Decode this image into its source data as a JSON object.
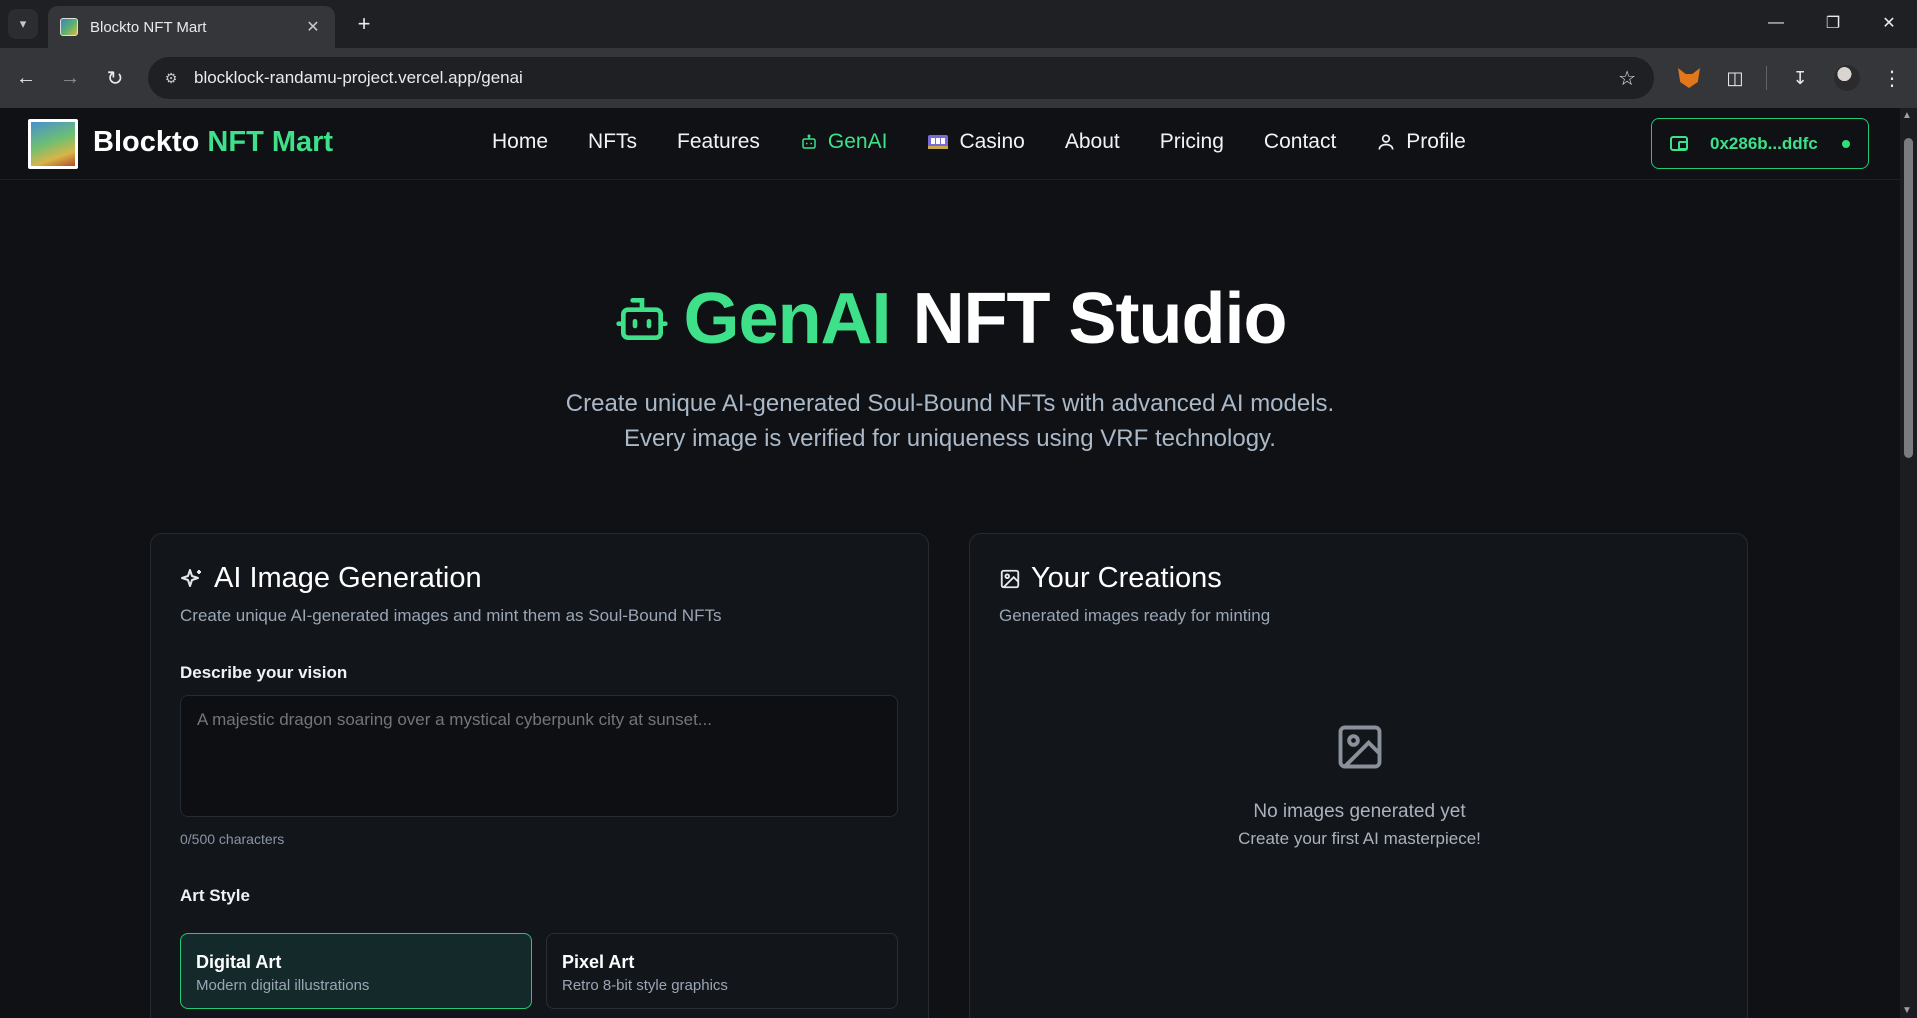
{
  "browser": {
    "tab_title": "Blockto NFT Mart",
    "url": "blocklock-randamu-project.vercel.app/genai"
  },
  "site": {
    "brand_main": "Blockto",
    "brand_accent": "NFT Mart",
    "nav": [
      {
        "label": "Home",
        "icon": ""
      },
      {
        "label": "NFTs",
        "icon": ""
      },
      {
        "label": "Features",
        "icon": ""
      },
      {
        "label": "GenAI",
        "icon": "bot-icon",
        "active": true
      },
      {
        "label": "Casino",
        "icon": "slot-machine-icon"
      },
      {
        "label": "About",
        "icon": ""
      },
      {
        "label": "Pricing",
        "icon": ""
      },
      {
        "label": "Contact",
        "icon": ""
      },
      {
        "label": "Profile",
        "icon": "user-icon"
      }
    ],
    "wallet_address": "0x286b...ddfc"
  },
  "hero": {
    "title_accent": "GenAI",
    "title_rest": "NFT Studio",
    "subtitle_line1": "Create unique AI-generated Soul-Bound NFTs with advanced AI models.",
    "subtitle_line2": "Every image is verified for uniqueness using VRF technology."
  },
  "generation": {
    "title": "AI Image Generation",
    "description": "Create unique AI-generated images and mint them as Soul-Bound NFTs",
    "prompt_label": "Describe your vision",
    "prompt_placeholder": "A majestic dragon soaring over a mystical cyberpunk city at sunset...",
    "char_count": "0/500 characters",
    "style_label": "Art Style",
    "styles": [
      {
        "name": "Digital Art",
        "desc": "Modern digital illustrations",
        "selected": true
      },
      {
        "name": "Pixel Art",
        "desc": "Retro 8-bit style graphics",
        "selected": false
      }
    ]
  },
  "creations": {
    "title": "Your Creations",
    "description": "Generated images ready for minting",
    "empty_title": "No images generated yet",
    "empty_subtitle": "Create your first AI masterpiece!"
  },
  "colors": {
    "accent": "#3ee08a",
    "background": "#0f1115",
    "card": "#12151a"
  }
}
